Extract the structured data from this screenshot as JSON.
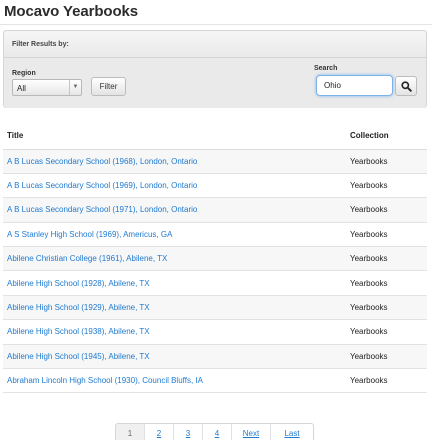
{
  "page": {
    "title": "Mocavo Yearbooks"
  },
  "filter": {
    "heading": "Filter Results by:",
    "region_label": "Region",
    "region_value": "All",
    "filter_button": "Filter",
    "search_label": "Search",
    "search_value": "Ohio",
    "icons": {
      "dropdown": "chevron-down-icon",
      "search": "search-icon"
    }
  },
  "table": {
    "headers": {
      "title": "Title",
      "collection": "Collection"
    },
    "rows": [
      {
        "title": "A B Lucas Secondary School (1968), London, Ontario",
        "collection": "Yearbooks"
      },
      {
        "title": "A B Lucas Secondary School (1969), London, Ontario",
        "collection": "Yearbooks"
      },
      {
        "title": "A B Lucas Secondary School (1971), London, Ontario",
        "collection": "Yearbooks"
      },
      {
        "title": "A S Stanley High School (1969), Americus, GA",
        "collection": "Yearbooks"
      },
      {
        "title": "Abilene Christian College (1961), Abilene, TX",
        "collection": "Yearbooks"
      },
      {
        "title": "Abilene High School (1928), Abilene, TX",
        "collection": "Yearbooks"
      },
      {
        "title": "Abilene High School (1929), Abilene, TX",
        "collection": "Yearbooks"
      },
      {
        "title": "Abilene High School (1938), Abilene, TX",
        "collection": "Yearbooks"
      },
      {
        "title": "Abilene High School (1945), Abilene, TX",
        "collection": "Yearbooks"
      },
      {
        "title": "Abraham Lincoln High School (1930), Council Bluffs, IA",
        "collection": "Yearbooks"
      }
    ]
  },
  "pagination": {
    "current_page": "1",
    "pages": [
      "2",
      "3",
      "4"
    ],
    "next": "Next",
    "last": "Last"
  },
  "colors": {
    "link": "#1f7ad0",
    "search_focus": "#7fb2e8"
  }
}
